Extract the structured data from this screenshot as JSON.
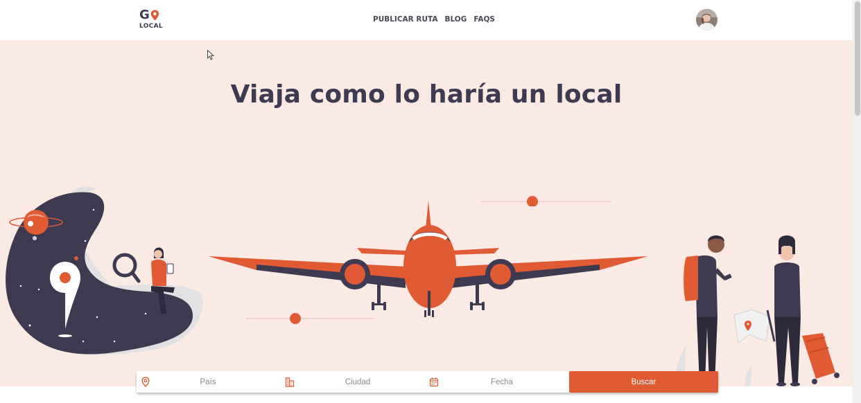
{
  "brand": {
    "logo_letter": "G",
    "logo_word": "LOCAL"
  },
  "nav": {
    "items": [
      {
        "label": "PUBLICAR RUTA"
      },
      {
        "label": "BLOG"
      },
      {
        "label": "FAQS"
      }
    ]
  },
  "hero": {
    "title": "Viaja como lo haría un local"
  },
  "search": {
    "country_placeholder": "País",
    "city_placeholder": "Ciudad",
    "date_placeholder": "Fecha",
    "submit_label": "Buscar"
  },
  "colors": {
    "accent": "#e05a33",
    "dark": "#3e3a52",
    "hero_bg": "#fbe9e4"
  },
  "icons": {
    "logo": "map-pin-icon",
    "country": "map-pin-icon",
    "city": "buildings-icon",
    "date": "calendar-icon"
  }
}
